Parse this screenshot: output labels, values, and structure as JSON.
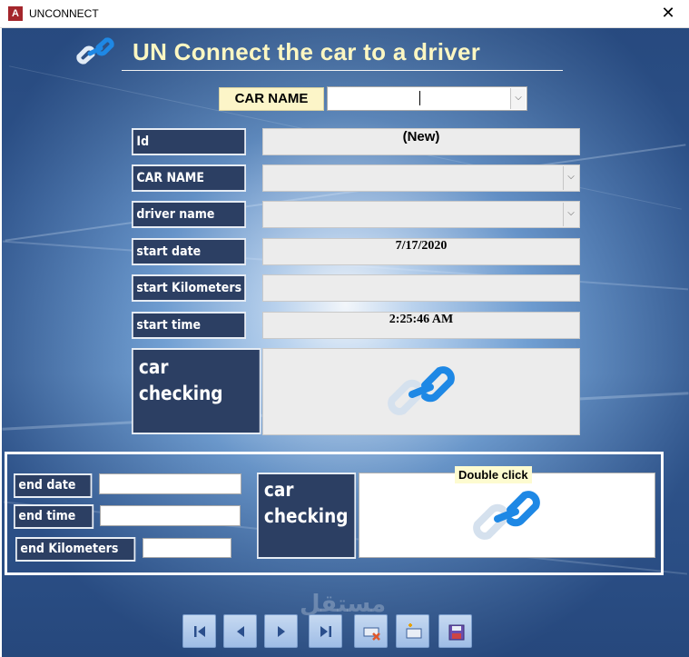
{
  "window": {
    "title": "UNCONNECT",
    "app_icon_text": "A",
    "close_symbol": "✕"
  },
  "form": {
    "title": "UN Connect the car to a driver",
    "header_icon": "link-icon"
  },
  "search": {
    "label": "CAR NAME",
    "value": ""
  },
  "fields": {
    "id": {
      "label": "Id",
      "value": "(New)"
    },
    "car_name": {
      "label": "CAR NAME",
      "value": ""
    },
    "driver_name": {
      "label": "driver name",
      "value": ""
    },
    "start_date": {
      "label": "start date",
      "value": "7/17/2020"
    },
    "start_km": {
      "label": "start Kilometers",
      "value": ""
    },
    "start_time": {
      "label": "start time",
      "value": "2:25:46 AM"
    }
  },
  "car_checking_start": {
    "label_line1": "car",
    "label_line2": "checking",
    "icon": "link-icon"
  },
  "end_section": {
    "end_date": {
      "label": "end date",
      "value": ""
    },
    "end_time": {
      "label": "end time",
      "value": ""
    },
    "end_km": {
      "label": "end Kilometers",
      "value": ""
    },
    "car_checking": {
      "label_line1": "car",
      "label_line2": "checking",
      "hint": "Double click",
      "icon": "link-icon"
    }
  },
  "nav": {
    "buttons": [
      "first-record-icon",
      "previous-record-icon",
      "next-record-icon",
      "last-record-icon",
      "delete-record-icon",
      "new-record-icon",
      "save-record-icon"
    ]
  },
  "watermark": "مستقل",
  "colors": {
    "label_bg": "#2c3f63",
    "title_text": "#fcf7c2",
    "link_blue": "#1e88e5",
    "link_light": "#d5e1ee"
  }
}
